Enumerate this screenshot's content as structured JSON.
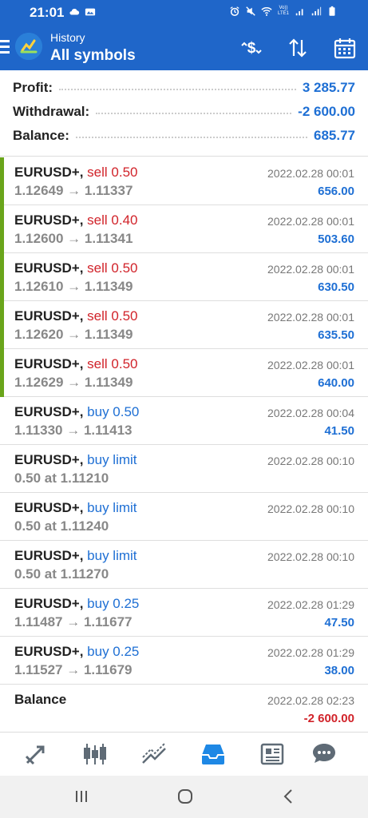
{
  "status": {
    "time": "21:01",
    "left_icons": [
      "cloud-icon",
      "gallery-icon"
    ],
    "right_icons": [
      "alarm-icon",
      "mute-icon",
      "wifi-icon",
      "volte-icon",
      "signal-icon",
      "signal-icon-2",
      "battery-icon"
    ],
    "volte_text": "Vo)) LTE1"
  },
  "appbar": {
    "small_title": "History",
    "big_title": "All symbols",
    "actions": [
      "currency-icon",
      "sort-icon",
      "calendar-icon"
    ]
  },
  "summary": [
    {
      "label": "Profit:",
      "value": "3 285.77"
    },
    {
      "label": "Withdrawal:",
      "value": "-2 600.00"
    },
    {
      "label": "Balance:",
      "value": "685.77"
    }
  ],
  "deals": [
    {
      "symbol": "EURUSD+,",
      "type": "sell 0.50",
      "kind": "sell",
      "prices": "1.12649 → 1.11337",
      "time": "2022.02.28 00:01",
      "profit": "656.00",
      "bar": true
    },
    {
      "symbol": "EURUSD+,",
      "type": "sell 0.40",
      "kind": "sell",
      "prices": "1.12600 → 1.11341",
      "time": "2022.02.28 00:01",
      "profit": "503.60",
      "bar": true
    },
    {
      "symbol": "EURUSD+,",
      "type": "sell 0.50",
      "kind": "sell",
      "prices": "1.12610 → 1.11349",
      "time": "2022.02.28 00:01",
      "profit": "630.50",
      "bar": true
    },
    {
      "symbol": "EURUSD+,",
      "type": "sell 0.50",
      "kind": "sell",
      "prices": "1.12620 → 1.11349",
      "time": "2022.02.28 00:01",
      "profit": "635.50",
      "bar": true
    },
    {
      "symbol": "EURUSD+,",
      "type": "sell 0.50",
      "kind": "sell",
      "prices": "1.12629 → 1.11349",
      "time": "2022.02.28 00:01",
      "profit": "640.00",
      "bar": true
    },
    {
      "symbol": "EURUSD+,",
      "type": "buy 0.50",
      "kind": "buy",
      "prices": "1.11330 → 1.11413",
      "time": "2022.02.28 00:04",
      "profit": "41.50",
      "bar": false
    },
    {
      "symbol": "EURUSD+,",
      "type": "buy limit",
      "kind": "buy",
      "prices": "0.50 at 1.11210",
      "time": "2022.02.28 00:10",
      "profit": "",
      "bar": false
    },
    {
      "symbol": "EURUSD+,",
      "type": "buy limit",
      "kind": "buy",
      "prices": "0.50 at 1.11240",
      "time": "2022.02.28 00:10",
      "profit": "",
      "bar": false
    },
    {
      "symbol": "EURUSD+,",
      "type": "buy limit",
      "kind": "buy",
      "prices": "0.50 at 1.11270",
      "time": "2022.02.28 00:10",
      "profit": "",
      "bar": false
    },
    {
      "symbol": "EURUSD+,",
      "type": "buy 0.25",
      "kind": "buy",
      "prices": "1.11487 → 1.11677",
      "time": "2022.02.28 01:29",
      "profit": "47.50",
      "bar": false
    },
    {
      "symbol": "EURUSD+,",
      "type": "buy 0.25",
      "kind": "buy",
      "prices": "1.11527 → 1.11679",
      "time": "2022.02.28 01:29",
      "profit": "38.00",
      "bar": false
    },
    {
      "symbol": "Balance",
      "type": "",
      "kind": "",
      "prices": "",
      "time": "2022.02.28 02:23",
      "profit": "-2 600.00",
      "bar": false
    }
  ],
  "tabs": [
    {
      "name": "quotes-tab",
      "icon": "quotes-arrows-icon",
      "active": false
    },
    {
      "name": "chart-tab",
      "icon": "candlestick-icon",
      "active": false
    },
    {
      "name": "trade-tab",
      "icon": "trend-lines-icon",
      "active": false
    },
    {
      "name": "history-tab",
      "icon": "inbox-tray-icon",
      "active": true
    },
    {
      "name": "news-tab",
      "icon": "newspaper-icon",
      "active": false
    },
    {
      "name": "messages-tab",
      "icon": "chat-bubble-icon",
      "active": false
    }
  ],
  "colors": {
    "primary": "#1f66c9",
    "sell": "#d1232a",
    "buy": "#1e6fd4",
    "bar": "#6aa51b",
    "active_tab": "#1e88e5",
    "inactive_tab": "#5f6b76"
  }
}
